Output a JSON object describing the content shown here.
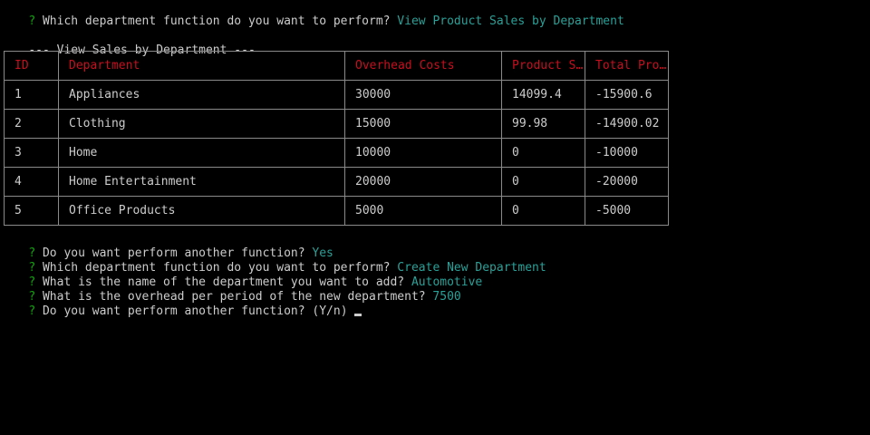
{
  "prompt_marker": "?",
  "lines": [
    {
      "question": " Which department function do you want to perform?",
      "answer": " View Product Sales by Department"
    }
  ],
  "section_header": "--- View Sales by Department ---",
  "table": {
    "headers": [
      "ID",
      "Department",
      "Overhead Costs",
      "Product S…",
      "Total Pro…"
    ],
    "rows": [
      [
        "1",
        "Appliances",
        "30000",
        "14099.4",
        "-15900.6"
      ],
      [
        "2",
        "Clothing",
        "15000",
        "99.98",
        "-14900.02"
      ],
      [
        "3",
        "Home",
        "10000",
        "0",
        "-10000"
      ],
      [
        "4",
        "Home Entertainment",
        "20000",
        "0",
        "-20000"
      ],
      [
        "5",
        "Office Products",
        "5000",
        "0",
        "-5000"
      ]
    ]
  },
  "after_lines": [
    {
      "question": " Do you want perform another function?",
      "answer": " Yes"
    },
    {
      "question": " Which department function do you want to perform?",
      "answer": " Create New Department"
    },
    {
      "question": " What is the name of the department you want to add?",
      "answer": " Automotive"
    },
    {
      "question": " What is the overhead per period of the new department?",
      "answer": " 7500"
    },
    {
      "question": " Do you want perform another function?",
      "answer": " (Y/n) "
    }
  ],
  "colors": {
    "prompt_marker": "#13a10e",
    "answer": "#2aa198",
    "header_text": "#c50f1f",
    "border": "#8a8a8a",
    "text": "#cccccc",
    "background": "#000000"
  }
}
